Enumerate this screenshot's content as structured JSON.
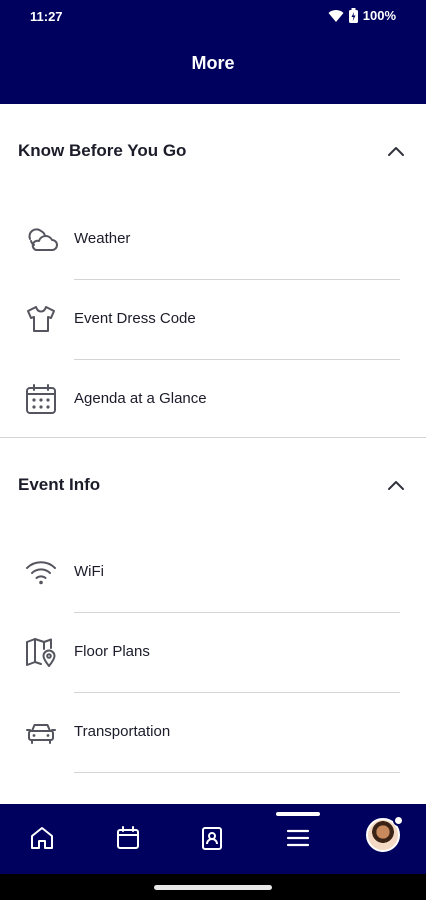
{
  "status_bar": {
    "time": "11:27",
    "battery": "100%"
  },
  "header": {
    "title": "More"
  },
  "sections": [
    {
      "title": "Know Before You Go",
      "items": [
        {
          "label": "Weather",
          "icon": "cloud-icon"
        },
        {
          "label": "Event Dress Code",
          "icon": "shirt-icon"
        },
        {
          "label": "Agenda at a Glance",
          "icon": "calendar-grid-icon"
        }
      ]
    },
    {
      "title": "Event Info",
      "items": [
        {
          "label": "WiFi",
          "icon": "wifi-icon"
        },
        {
          "label": "Floor Plans",
          "icon": "map-pin-icon"
        },
        {
          "label": "Transportation",
          "icon": "car-icon"
        }
      ]
    }
  ],
  "bottom_nav": {
    "items": [
      "home-icon",
      "calendar-icon",
      "contacts-icon",
      "menu-icon",
      "avatar"
    ],
    "active": "menu-icon"
  },
  "colors": {
    "brand": "#00005e",
    "icon": "#55555f",
    "divider": "#d4d4d8"
  }
}
